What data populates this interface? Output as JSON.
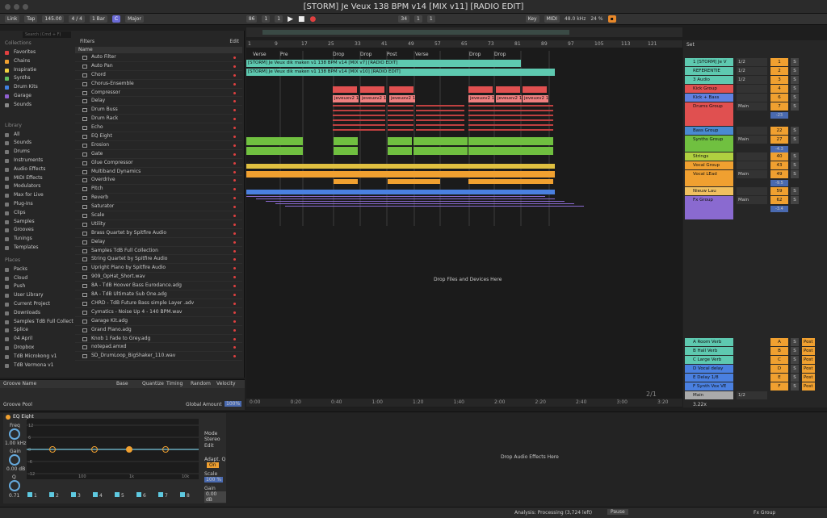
{
  "title": "[STORM] Je Veux 138 BPM v14 [MIX v11] [RADIO EDIT]",
  "control": {
    "link": "Link",
    "tap": "Tap",
    "bpm": "145.00",
    "sig": "4 / 4",
    "bar": "1 Bar",
    "key": "C",
    "scale": "Major",
    "pos1": "86",
    "pos2": "1",
    "pos3": "1",
    "loop1": "34",
    "loop2": "1",
    "loop3": "1",
    "keylabel": "Key",
    "midi": "MIDI",
    "rate": "48.0 kHz",
    "cpu": "24 %"
  },
  "browser": {
    "search": "Search (Cmd + F)",
    "collections_label": "Collections",
    "collections": [
      {
        "label": "Favorites",
        "color": "#e04040"
      },
      {
        "label": "Chains",
        "color": "#f0a030"
      },
      {
        "label": "Inspiratie",
        "color": "#f0d040"
      },
      {
        "label": "Synths",
        "color": "#60c060"
      },
      {
        "label": "Drum Kits",
        "color": "#4080e0"
      },
      {
        "label": "Garage",
        "color": "#9060d0"
      },
      {
        "label": "Sounds",
        "color": "#888888"
      }
    ],
    "library_label": "Library",
    "library": [
      "All",
      "Sounds",
      "Drums",
      "Instruments",
      "Audio Effects",
      "MIDI Effects",
      "Modulators",
      "Max for Live",
      "Plug-Ins",
      "Clips",
      "Samples",
      "Grooves",
      "Tunings",
      "Templates"
    ],
    "places_label": "Places",
    "places": [
      "Packs",
      "Cloud",
      "Push",
      "User Library",
      "Current Project",
      "Downloads",
      "Samples TdB Full Collecti",
      "Splice",
      "04 April",
      "Dropbox",
      "TdB Microkong v1",
      "TdB Vermona v1"
    ],
    "filters": "Filters",
    "edit": "Edit",
    "name_col": "Name",
    "files": [
      "Auto Filter",
      "Auto Pan",
      "Chord",
      "Chorus-Ensemble",
      "Compressor",
      "Delay",
      "Drum Buss",
      "Drum Rack",
      "Echo",
      "EQ Eight",
      "Erosion",
      "Gate",
      "Glue Compressor",
      "Multiband Dynamics",
      "Overdrive",
      "Pitch",
      "Reverb",
      "Saturator",
      "Scale",
      "Utility",
      "Brass Quartet by Spitfire Audio",
      "Delay",
      "Samples TdB Full Collection",
      "String Quartet by Spitfire Audio",
      "Upright Piano by Spitfire Audio",
      "909_OpHat_Short.wav",
      "8A - TdB Hoover Bass Eurodance.adg",
      "8A - TdB Ultimate Sub One.adg",
      "CHRD - TdB Future Bass simple Layer .adv",
      "Cymatics - Noise Up 4 - 140 BPM.wav",
      "Garage Kit.adg",
      "Grand Piano.adg",
      "Knob 1 Fade to Grey.adg",
      "notepad.amxd",
      "SD_DrumLoop_BigShaker_110.wav"
    ]
  },
  "groove": {
    "cols": [
      "Groove Name",
      "Base",
      "Quantize",
      "Timing",
      "Random",
      "Velocity"
    ],
    "pool": "Groove Pool",
    "amount_label": "Global Amount",
    "amount": "100%"
  },
  "arrangement": {
    "ruler": [
      "1",
      "9",
      "17",
      "25",
      "33",
      "41",
      "49",
      "57",
      "65",
      "73",
      "81",
      "89",
      "97",
      "105",
      "113",
      "121"
    ],
    "scenes": [
      "Verse",
      "Pre",
      "Drop",
      "Drop",
      "Post",
      "Verse",
      "Drop",
      "Drop"
    ],
    "clip1": "[STORM] Je Veux dik maken v1 138 BPM v14 [MIX v7] [RADIO EDIT]",
    "clip2": "[STORM] Je Veux dik maken v1 138 BPM v14 [MIX v10] [RADIO EDIT]",
    "vocal_clips": [
      "jeveuxv2 1",
      "jeveuxv2 1",
      "jeveuxv2 1",
      "jeveuxv2 1",
      "jeveuxv2 1",
      "jeveuxv2 1"
    ],
    "drop_text": "Drop Files and Devices Here",
    "times": [
      "0:00",
      "0:20",
      "0:40",
      "1:00",
      "1:20",
      "1:40",
      "2:00",
      "2:20",
      "2:40",
      "3:00",
      "3:20"
    ],
    "page": "2/1"
  },
  "mixer": {
    "set": "Set",
    "tracks": [
      {
        "name": "1 [STORM] Je V",
        "color": "#5ec9b0",
        "io": "1/2",
        "num": "1"
      },
      {
        "name": "REFERENTIE",
        "color": "#5ec9b0",
        "io": "1/2",
        "num": "2"
      },
      {
        "name": "3 Audio",
        "color": "#5ec9b0",
        "io": "1/2",
        "num": "3"
      },
      {
        "name": "Kick Group",
        "color": "#e05050",
        "io": "",
        "num": "4"
      },
      {
        "name": "Kick + Bass",
        "color": "#6080e0",
        "io": "",
        "num": "6"
      },
      {
        "name": "Drums Group",
        "color": "#e05050",
        "io": "Main",
        "num": "7"
      },
      {
        "name": "Bass Group",
        "color": "#4a8ad0",
        "io": "",
        "num": "22"
      },
      {
        "name": "Synths Group",
        "color": "#70c040",
        "io": "Main",
        "num": "27"
      },
      {
        "name": "Strings",
        "color": "#b0d040",
        "io": "",
        "num": "40"
      },
      {
        "name": "Vocal Group",
        "color": "#f0a030",
        "io": "",
        "num": "43"
      },
      {
        "name": "Vocal LEad",
        "color": "#f0a030",
        "io": "Main",
        "num": "49"
      },
      {
        "name": "Nieuw Lau",
        "color": "#f0c060",
        "io": "",
        "num": "59"
      },
      {
        "name": "Fx Group",
        "color": "#8a6ad0",
        "io": "Main",
        "num": "62"
      }
    ],
    "vals": [
      "-23",
      "-4.3",
      "-9.5",
      "-3.4"
    ],
    "returns": [
      {
        "name": "A Room Verb",
        "num": "A"
      },
      {
        "name": "B Hall Verb",
        "num": "B"
      },
      {
        "name": "C Large Verb",
        "num": "C"
      },
      {
        "name": "D Vocal delay",
        "num": "D"
      },
      {
        "name": "E Delay 1/8",
        "num": "E"
      },
      {
        "name": "F Synth Vox VE",
        "num": "F"
      }
    ],
    "post": "Post",
    "main": "Main",
    "main_io": "1/2",
    "zoom": "3.22x"
  },
  "device": {
    "name": "EQ Eight",
    "freq_label": "Freq",
    "freq": "1.00 kHz",
    "gain_label": "Gain",
    "gain": "0.00 dB",
    "q_label": "Q",
    "q": "0.71",
    "mode_label": "Mode",
    "mode": "Stereo",
    "edit": "Edit",
    "adapt_label": "Adapt. Q",
    "adapt": "On",
    "scale_label": "Scale",
    "scale": "100 %",
    "gain2_label": "Gain",
    "gain2": "0.00 dB",
    "y_ticks": [
      "12",
      "6",
      "0",
      "-6",
      "-12"
    ],
    "x_ticks": [
      "100",
      "1k",
      "10k"
    ],
    "bands": [
      "1",
      "2",
      "3",
      "4",
      "5",
      "6",
      "7",
      "8"
    ],
    "drop_text": "Drop Audio Effects Here"
  },
  "status": {
    "analysis": "Analysis: Processing (3,724 left)",
    "pause": "Pause",
    "track": "Fx Group"
  }
}
